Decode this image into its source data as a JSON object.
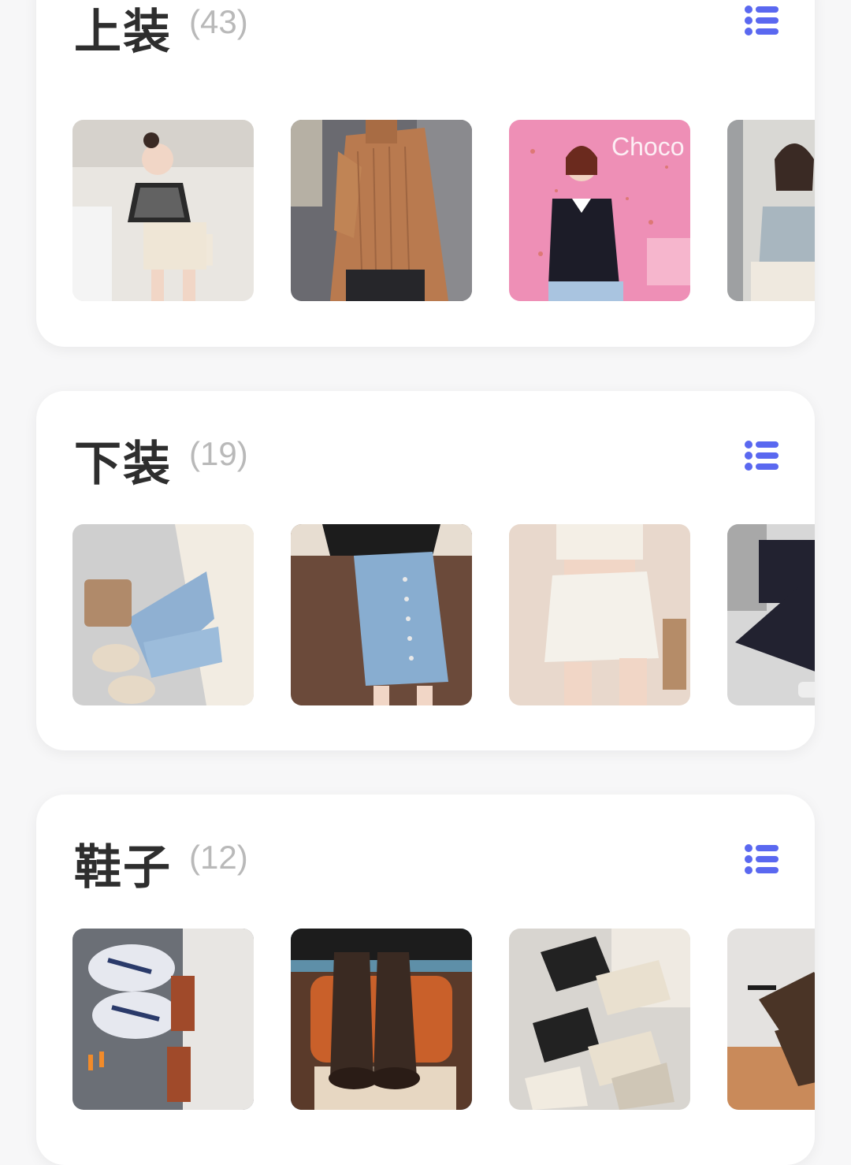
{
  "sections": [
    {
      "title": "上装",
      "count": "(43)",
      "list_icon": "list-icon",
      "accent_color": "#5a68f0",
      "items": [
        {
          "name": "checkered-crop-top",
          "bg": "#e9e6e1",
          "fg": "#2a2a2a"
        },
        {
          "name": "camel-ribbed-turtleneck",
          "bg": "#5f5f64",
          "fg": "#b97a4f"
        },
        {
          "name": "black-collar-knit",
          "bg": "#ee8fb6",
          "fg": "#1c1c28"
        },
        {
          "name": "blue-collar-blouse",
          "bg": "#d9d8d4",
          "fg": "#a8b6bf"
        }
      ]
    },
    {
      "title": "下装",
      "count": "(19)",
      "list_icon": "list-icon",
      "accent_color": "#5a68f0",
      "items": [
        {
          "name": "light-wash-jeans",
          "bg": "#cfcfcf",
          "fg": "#8fb0d2"
        },
        {
          "name": "denim-button-skirt",
          "bg": "#6b4a3a",
          "fg": "#88add0"
        },
        {
          "name": "white-denim-shorts",
          "bg": "#e8d8cc",
          "fg": "#f4f1ea"
        },
        {
          "name": "black-leggings",
          "bg": "#d7d7d7",
          "fg": "#222230"
        }
      ]
    },
    {
      "title": "鞋子",
      "count": "(12)",
      "list_icon": "list-icon",
      "accent_color": "#5a68f0",
      "items": [
        {
          "name": "chunky-sneakers",
          "bg": "#6b6f76",
          "fg": "#e6e8ef"
        },
        {
          "name": "leather-lace-boots",
          "bg": "#c9602a",
          "fg": "#3a2a22"
        },
        {
          "name": "canvas-sneakers-set",
          "bg": "#d8d5d0",
          "fg": "#222222"
        },
        {
          "name": "brown-loafers",
          "bg": "#e4e2e0",
          "fg": "#4a3426"
        }
      ]
    }
  ]
}
